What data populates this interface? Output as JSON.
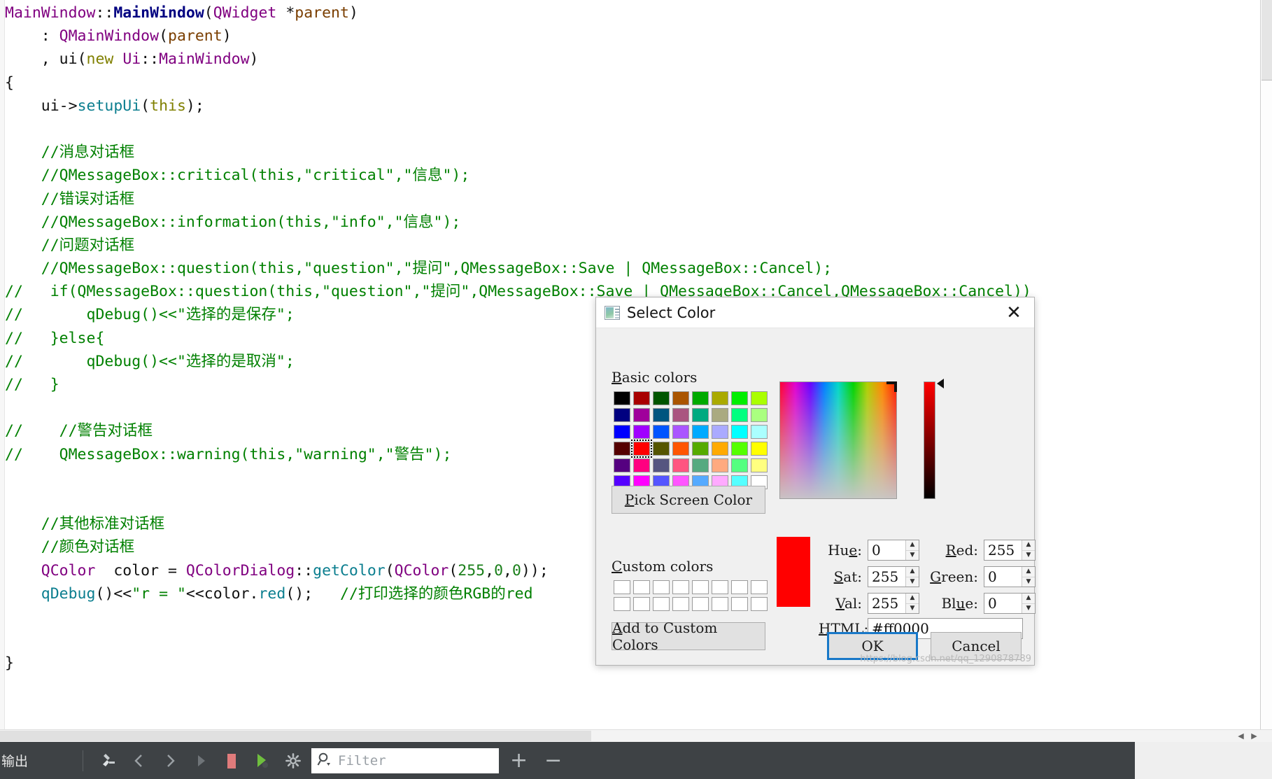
{
  "editor": {
    "language": "cpp",
    "lines": [
      [
        [
          "MainWindow",
          "cls"
        ],
        [
          "::",
          "op"
        ],
        [
          "MainWindow",
          "bold"
        ],
        [
          "(",
          "op"
        ],
        [
          "QWidget",
          "cls"
        ],
        [
          " ",
          "plain"
        ],
        [
          "*",
          "op"
        ],
        [
          "parent",
          "var"
        ],
        [
          ")",
          "op"
        ]
      ],
      [
        [
          "    : ",
          "op"
        ],
        [
          "QMainWindow",
          "cls"
        ],
        [
          "(",
          "op"
        ],
        [
          "parent",
          "var"
        ],
        [
          ")",
          "op"
        ]
      ],
      [
        [
          "    , ",
          "op"
        ],
        [
          "ui",
          "plain"
        ],
        [
          "(",
          "op"
        ],
        [
          "new",
          "kw"
        ],
        [
          " ",
          "plain"
        ],
        [
          "Ui",
          "cls"
        ],
        [
          "::",
          "op"
        ],
        [
          "MainWindow",
          "cls"
        ],
        [
          ")",
          "op"
        ]
      ],
      [
        [
          "{",
          "op"
        ]
      ],
      [
        [
          "    ",
          "plain"
        ],
        [
          "ui",
          "plain"
        ],
        [
          "->",
          "op"
        ],
        [
          "setupUi",
          "fn"
        ],
        [
          "(",
          "op"
        ],
        [
          "this",
          "kw"
        ],
        [
          ");",
          "op"
        ]
      ],
      [
        [
          "",
          "plain"
        ]
      ],
      [
        [
          "    //消息对话框",
          "com"
        ]
      ],
      [
        [
          "    //QMessageBox::critical(this,\"critical\",\"信息\");",
          "com"
        ]
      ],
      [
        [
          "    //错误对话框",
          "com"
        ]
      ],
      [
        [
          "    //QMessageBox::information(this,\"info\",\"信息\");",
          "com"
        ]
      ],
      [
        [
          "    //问题对话框",
          "com"
        ]
      ],
      [
        [
          "    //QMessageBox::question(this,\"question\",\"提问\",QMessageBox::Save | QMessageBox::Cancel);",
          "com"
        ]
      ],
      [
        [
          "//   if(QMessageBox::question(this,\"question\",\"提问\",QMessageBox::Save | QMessageBox::Cancel,QMessageBox::Cancel))",
          "com"
        ]
      ],
      [
        [
          "//       qDebug()<<\"选择的是保存\";",
          "com"
        ]
      ],
      [
        [
          "//   }else{",
          "com"
        ]
      ],
      [
        [
          "//       qDebug()<<\"选择的是取消\";",
          "com"
        ]
      ],
      [
        [
          "//   }",
          "com"
        ]
      ],
      [
        [
          "",
          "plain"
        ]
      ],
      [
        [
          "//    //警告对话框",
          "com"
        ]
      ],
      [
        [
          "//    QMessageBox::warning(this,\"warning\",\"警告\");",
          "com"
        ]
      ],
      [
        [
          "",
          "plain"
        ]
      ],
      [
        [
          "",
          "plain"
        ]
      ],
      [
        [
          "    //其他标准对话框",
          "com"
        ]
      ],
      [
        [
          "    //颜色对话框",
          "com"
        ]
      ],
      [
        [
          "    ",
          "plain"
        ],
        [
          "QColor",
          "cls"
        ],
        [
          "  ",
          "plain"
        ],
        [
          "color",
          "plain"
        ],
        [
          " = ",
          "op"
        ],
        [
          "QColorDialog",
          "cls"
        ],
        [
          "::",
          "op"
        ],
        [
          "getColor",
          "fn"
        ],
        [
          "(",
          "op"
        ],
        [
          "QColor",
          "cls"
        ],
        [
          "(",
          "op"
        ],
        [
          "255",
          "num"
        ],
        [
          ",",
          "op"
        ],
        [
          "0",
          "num"
        ],
        [
          ",",
          "op"
        ],
        [
          "0",
          "num"
        ],
        [
          "));",
          "op"
        ]
      ],
      [
        [
          "    ",
          "plain"
        ],
        [
          "qDebug",
          "fn"
        ],
        [
          "()",
          "op"
        ],
        [
          "<<",
          "op"
        ],
        [
          "\"r = \"",
          "str"
        ],
        [
          "<<",
          "op"
        ],
        [
          "color",
          "plain"
        ],
        [
          ".",
          "op"
        ],
        [
          "red",
          "fn"
        ],
        [
          "();   ",
          "op"
        ],
        [
          "//打印选择的颜色RGB的red",
          "com"
        ]
      ],
      [
        [
          "",
          "plain"
        ]
      ],
      [
        [
          "",
          "plain"
        ]
      ],
      [
        [
          "}",
          "op"
        ]
      ]
    ]
  },
  "bottombar": {
    "output_label": "输出",
    "filter_placeholder": "Filter",
    "icons": [
      "build-hammer-icon",
      "nav-back-icon",
      "nav-forward-icon",
      "run-play-icon",
      "stop-square-icon",
      "debug-run-icon",
      "settings-gear-icon"
    ],
    "search_icon": "search-icon",
    "zoom_in_label": "+",
    "zoom_out_label": "−"
  },
  "dialog": {
    "title": "Select Color",
    "title_icon": "color-dialog-icon",
    "close_icon": "close-icon",
    "basic_colors_label_pre": "B",
    "basic_colors_label_post": "asic colors",
    "custom_colors_label_pre": "C",
    "custom_colors_label_post": "ustom colors",
    "pick_screen_color_pre": "P",
    "pick_screen_color_post": "ick Screen Color",
    "add_custom_pre": "A",
    "add_custom_post": "dd to Custom Colors",
    "basic_colors": [
      "#000000",
      "#00007f",
      "#0000ff",
      "#3f0000",
      "#3f007f",
      "#5500ff",
      "#aa0000",
      "#a000a0",
      "#a000ff",
      "#ff0000",
      "#ff0080",
      "#ff00ff",
      "#005500",
      "#00557f",
      "#0055ff",
      "#555500",
      "#55557f",
      "#5555ff",
      "#aa5500",
      "#aa557f",
      "#aa55ff",
      "#ff5500",
      "#ff557f",
      "#ff55ff",
      "#00aa00",
      "#00aa7f",
      "#00aaff",
      "#55aa00",
      "#55aa7f",
      "#55aaff",
      "#aaaa00",
      "#aaaa7f",
      "#aaaaff",
      "#ffaa00",
      "#ffaa7f",
      "#ffaaff",
      "#00ff00",
      "#00ff7f",
      "#00ffff",
      "#55ff00",
      "#55ff7f",
      "#55ffff",
      "#aaff00",
      "#aaff7f",
      "#aaffff",
      "#ffff00",
      "#ffff7f",
      "#ffffff"
    ],
    "basic_colors_grid": [
      [
        "#000000",
        "#a80000",
        "#005500",
        "#aa5500",
        "#00aa00",
        "#aaaa00",
        "#00ee00",
        "#aaff00"
      ],
      [
        "#000080",
        "#a0009b",
        "#00557f",
        "#aa5580",
        "#00aa80",
        "#aaaa80",
        "#00ff80",
        "#aaff80"
      ],
      [
        "#0000ff",
        "#a000ff",
        "#0055ff",
        "#aa55ff",
        "#00aaff",
        "#aaaaff",
        "#00ffff",
        "#aaffff"
      ],
      [
        "#550000",
        "#ff0000",
        "#555500",
        "#ff5500",
        "#55aa00",
        "#ffaa00",
        "#55ff00",
        "#ffff00"
      ],
      [
        "#550080",
        "#ff0080",
        "#555580",
        "#ff5580",
        "#55aa80",
        "#ffaa80",
        "#55ff80",
        "#ffff80"
      ],
      [
        "#5500ff",
        "#ff00ff",
        "#5555ff",
        "#ff55ff",
        "#55aaff",
        "#ffaaff",
        "#55ffff",
        "#ffffff"
      ]
    ],
    "selected_basic": {
      "row": 3,
      "col": 1
    },
    "custom_color_slots": 16,
    "custom_color_empty": "#ffffff",
    "preview_color": "#ff0000",
    "fields": {
      "hue": {
        "label_pre": "Hu",
        "label_mid": "e",
        "label_post": ":",
        "value": "0"
      },
      "sat": {
        "label_pre": "",
        "label_mid": "S",
        "label_post": "at:",
        "value": "255"
      },
      "val": {
        "label_pre": "",
        "label_mid": "V",
        "label_post": "al:",
        "value": "255"
      },
      "red": {
        "label_pre": "",
        "label_mid": "R",
        "label_post": "ed:",
        "value": "255"
      },
      "green": {
        "label_pre": "",
        "label_mid": "G",
        "label_post": "reen:",
        "value": "0"
      },
      "blue": {
        "label_pre": "Bl",
        "label_mid": "u",
        "label_post": "e:",
        "value": "0"
      },
      "html": {
        "label_pre": "H",
        "label_mid": "",
        "label_post": "TML:",
        "value": "#ff0000"
      }
    },
    "spin_up_glyph": "▲",
    "spin_down_glyph": "▼",
    "ok_label": "OK",
    "cancel_label": "Cancel"
  },
  "watermark": "https://blog.csdn.net/qq_1290878789"
}
